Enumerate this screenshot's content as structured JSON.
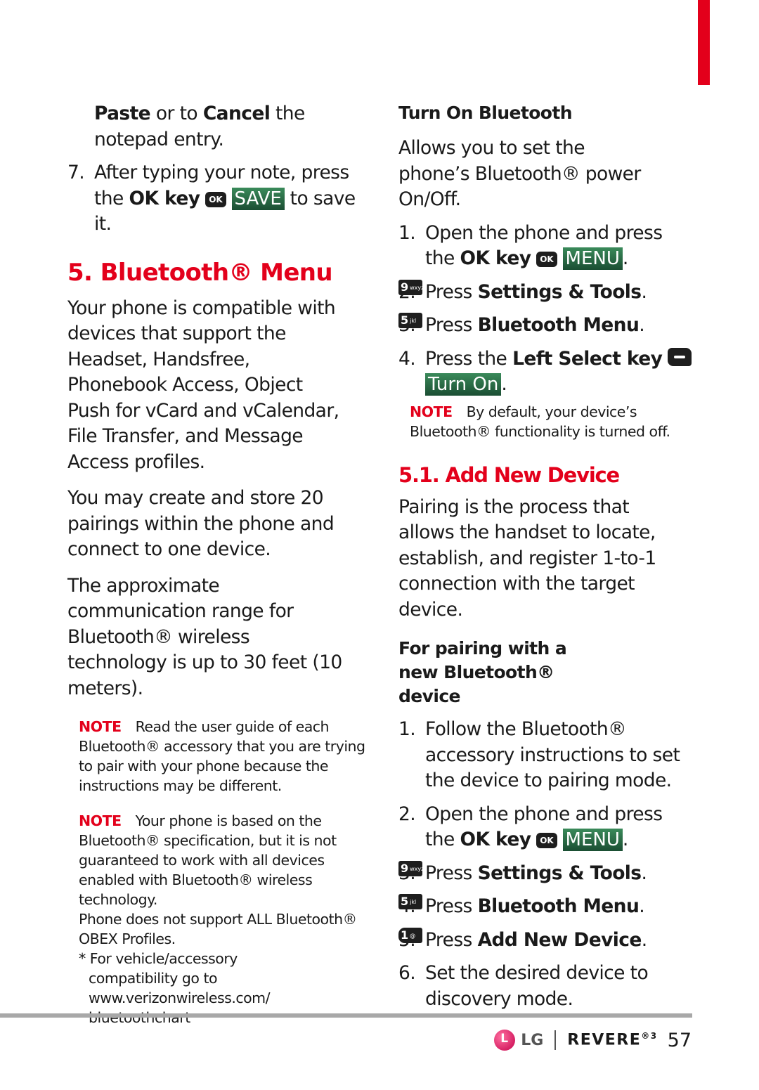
{
  "left": {
    "continued_text_1_bold": "Paste",
    "continued_text_2": " or to ",
    "continued_text_3_bold": "Cancel",
    "continued_text_4": " the notepad entry.",
    "step7": {
      "num": "7.",
      "text_a": "After typing your note, press the ",
      "ok_key_label": "OK key",
      "ok_icon": "OK",
      "screen_label": "SAVE",
      "text_b": " to save it."
    },
    "heading": "5. Bluetooth® Menu",
    "para1": "Your phone is compatible with devices that support the Headset, Handsfree, Phonebook Access, Object Push for vCard and vCalendar, File Transfer, and Message Access profiles.",
    "para2": "You may create and store 20 pairings within the phone and connect to one device.",
    "para3": "The approximate communication range for Bluetooth® wireless technology is up to 30 feet (10 meters).",
    "note1": {
      "tag": "NOTE",
      "text": "Read the user guide of each Bluetooth® accessory that you are trying to pair with your phone because the instructions may be different."
    },
    "note2": {
      "tag": "NOTE",
      "text": "Your phone is based on the Bluetooth® specification, but it is not guaranteed to work with all devices enabled with Bluetooth® wireless technology.",
      "text2": "Phone does not support ALL Bluetooth® OBEX Profiles.",
      "text3": "* For vehicle/accessory compatibility go to www.verizonwireless.com/ bluetoothchart"
    }
  },
  "right": {
    "turn_on": {
      "heading": "Turn On Bluetooth",
      "intro": "Allows you to set the phone’s Bluetooth® power On/Off.",
      "step1": {
        "num": "1.",
        "text": "Open the phone and press the ",
        "bold": "OK key",
        "icon": "OK",
        "screen": "MENU",
        "end": "."
      },
      "step2": {
        "num": "2.",
        "text": "Press ",
        "key": "9",
        "key_sub": "wxyz",
        "bold": "Settings & Tools",
        "end": "."
      },
      "step3": {
        "num": "3.",
        "text": "Press ",
        "key": "5",
        "key_sub": "jkl",
        "bold": "Bluetooth Menu",
        "end": "."
      },
      "step4": {
        "num": "4.",
        "text": "Press the ",
        "bold": "Left Select key",
        "screen": "Turn On",
        "end": "."
      },
      "note": {
        "tag": "NOTE",
        "text": "By default, your device’s Bluetooth® functionality is turned off."
      }
    },
    "add_device": {
      "heading": "5.1. Add New Device",
      "intro": "Pairing is the process that allows the handset to locate, establish, and register 1-to-1 connection with the target device.",
      "subheading": "For pairing with a new Bluetooth® device",
      "step1": {
        "num": "1.",
        "text": "Follow the Bluetooth® accessory instructions to set the device to pairing mode."
      },
      "step2": {
        "num": "2.",
        "text": "Open the phone and press the ",
        "bold": "OK key",
        "icon": "OK",
        "screen": "MENU",
        "end": "."
      },
      "step3": {
        "num": "3.",
        "text": "Press ",
        "key": "9",
        "key_sub": "wxyz",
        "bold": "Settings & Tools",
        "end": "."
      },
      "step4": {
        "num": "4.",
        "text": "Press ",
        "key": "5",
        "key_sub": "jkl",
        "bold": "Bluetooth Menu",
        "end": "."
      },
      "step5": {
        "num": "5.",
        "text": "Press ",
        "key": "1",
        "key_sub": "@",
        "bold": "Add New Device",
        "end": "."
      },
      "step6": {
        "num": "6.",
        "text": "Set the desired device to discovery mode."
      }
    }
  },
  "footer": {
    "brand_logo": "LG",
    "product": "REVERE",
    "product_sup": "®3",
    "page_number": "57"
  },
  "colors": {
    "accent_red": "#e3001b",
    "screen_green": "#2a6b45",
    "key_black": "#1e1e1e"
  }
}
